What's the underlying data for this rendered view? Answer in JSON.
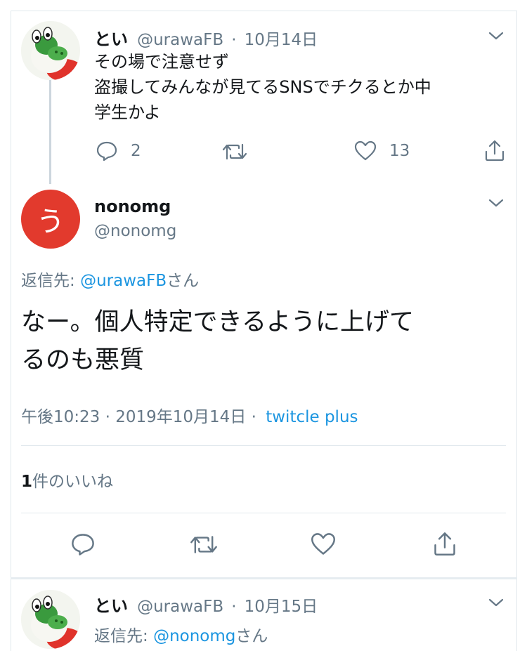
{
  "tweet1": {
    "name": "とい",
    "handle": "@urawaFB",
    "sep": "·",
    "date": "10月14日",
    "line1": "その場で注意せず",
    "line2": "盗撮してみんなが見てるSNSでチクるとか中",
    "line3": "学生かよ",
    "replies": "2",
    "likes": "13",
    "icons": [
      "reply-icon",
      "retweet-icon",
      "like-icon",
      "share-icon",
      "chevron-down-icon"
    ]
  },
  "main_tweet": {
    "avatar_char": "う",
    "name": "nonomg",
    "handle": "@nonomg",
    "reply_prefix": "返信先: ",
    "reply_handle": "@urawaFB",
    "reply_suffix": "さん",
    "text_line1": "なー。個人特定できるように上げて",
    "text_line2": "るのも悪質",
    "timestamp": "午後10:23 · 2019年10月14日 ·",
    "client": "twitcle plus",
    "likes_count": "1",
    "likes_unit": "件の",
    "likes_label": "いいね"
  },
  "tweet3": {
    "name": "とい",
    "handle": "@urawaFB",
    "sep": "·",
    "date": "10月15日",
    "reply_prefix": "返信先: ",
    "reply_handle": "@nonomg",
    "reply_suffix": "さん"
  },
  "colors": {
    "link": "#1b95e0",
    "muted": "#657786",
    "avatar_red": "#e23a2d",
    "divider": "#e1e8ed"
  }
}
